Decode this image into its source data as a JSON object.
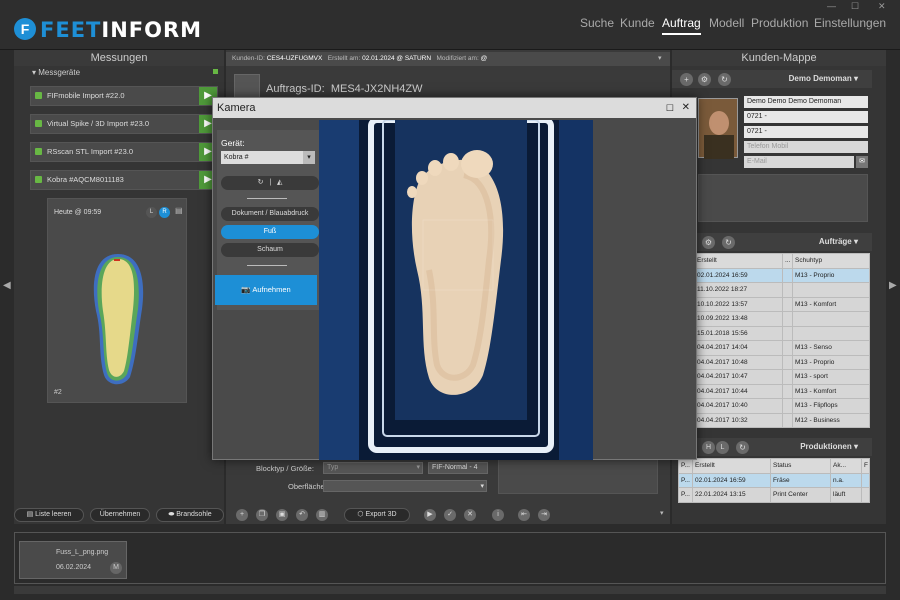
{
  "app": {
    "logo_left": "FEET",
    "logo_right": "INFORM",
    "logo_icon": "F"
  },
  "nav": [
    "Suche",
    "Kunde",
    "Auftrag",
    "Modell",
    "Produktion",
    "Einstellungen"
  ],
  "nav_active": "Auftrag",
  "left": {
    "title": "Messungen",
    "section": "Messgeräte",
    "devices": [
      "FIFmobile Import #22.0",
      "Virtual Spike / 3D Import #23.0",
      "RSscan STL Import #23.0",
      "Kobra #AQCM8011183"
    ],
    "scan": {
      "time": "Heute @ 09:59",
      "side_l": "L",
      "side_r": "R",
      "index": "#2"
    },
    "bottom": {
      "clear": "Liste leeren",
      "apply": "Übernehmen",
      "sole": "Brandsohle"
    }
  },
  "meta": {
    "customer_id_label": "Kunden-ID:",
    "customer_id": "CES4-UZFUGMVX",
    "created_label": "Erstellt am:",
    "created": "02.01.2024 @ SATURN",
    "modified_label": "Modifiziert am:",
    "modified": "@"
  },
  "order": {
    "label": "Auftrags-ID:",
    "id": "MES4-JX2NH4ZW"
  },
  "form": {
    "block_label": "Blocktyp / Größe:",
    "block_value": "Typ",
    "block_value2": "FIF-Normal - 4",
    "surface_label": "Oberfläche:"
  },
  "toolbar": {
    "export": "Export 3D"
  },
  "camera": {
    "title": "Kamera",
    "device_label": "Gerät:",
    "device_value": "Kobra #",
    "modes": [
      "Dokument / Blauabdruck",
      "Fuß",
      "Schaum"
    ],
    "active_mode": "Fuß",
    "capture": "Aufnehmen"
  },
  "customer": {
    "title": "Kunden-Mappe",
    "name_header": "Demo Demoman",
    "fields": [
      "Demo Demo Demo Demoman",
      "0721 -",
      "0721 -",
      "Telefon Mobil",
      "E-Mail"
    ]
  },
  "orders": {
    "title": "Aufträge",
    "columns": [
      "Erstellt",
      "...",
      "Schuhtyp"
    ],
    "rows": [
      [
        "02.01.2024 16:59",
        "",
        "M13 - Proprio"
      ],
      [
        "11.10.2022 18:27",
        "",
        ""
      ],
      [
        "10.10.2022 13:57",
        "",
        "M13 - Komfort"
      ],
      [
        "10.09.2022 13:48",
        "",
        ""
      ],
      [
        "15.01.2018 15:56",
        "",
        ""
      ],
      [
        "04.04.2017 14:04",
        "",
        "M13 - Senso"
      ],
      [
        "04.04.2017 10:48",
        "",
        "M13 - Proprio"
      ],
      [
        "04.04.2017 10:47",
        "",
        "M13 - sport"
      ],
      [
        "04.04.2017 10:44",
        "",
        "M13 - Komfort"
      ],
      [
        "04.04.2017 10:40",
        "",
        "M13 - Flipflops"
      ],
      [
        "04.04.2017 10:32",
        "",
        "M12 - Business"
      ]
    ]
  },
  "productions": {
    "title": "Produktionen",
    "h": "H",
    "l": "L",
    "columns": [
      "P...",
      "Erstellt",
      "Status",
      "Ak...",
      "F"
    ],
    "rows": [
      [
        "P...",
        "02.01.2024 16:59",
        "Fräse",
        "n.a.",
        ""
      ],
      [
        "P...",
        "22.01.2024 13:15",
        "Print Center",
        "läuft",
        ""
      ]
    ]
  },
  "thumb": {
    "name": "Fuss_L_png.png",
    "date": "06.02.2024",
    "badge": "M"
  },
  "colors": {
    "accent": "#1d8fd6",
    "go": "#4f9a3a",
    "selected_row": "#bcd9ec"
  }
}
